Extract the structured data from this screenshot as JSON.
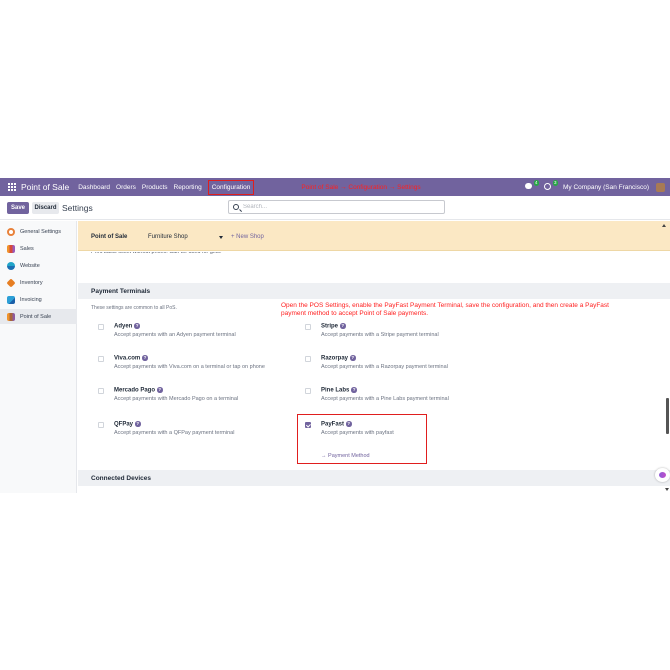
{
  "navbar": {
    "app_name": "Point of Sale",
    "menu": [
      "Dashboard",
      "Orders",
      "Products",
      "Reporting",
      "Configuration"
    ],
    "annotation": "Point of Sale → Configuration → Settings",
    "messages_count": "4",
    "activities_count": "3",
    "company": "My Company (San Francisco)"
  },
  "control": {
    "save_label": "Save",
    "discard_label": "Discard",
    "breadcrumb": "Settings",
    "search_placeholder": "Search..."
  },
  "sidebar": {
    "items": [
      {
        "label": "General Settings",
        "icon": "general-settings-icon"
      },
      {
        "label": "Sales",
        "icon": "sales-icon"
      },
      {
        "label": "Website",
        "icon": "website-icon"
      },
      {
        "label": "Inventory",
        "icon": "inventory-icon"
      },
      {
        "label": "Invoicing",
        "icon": "invoicing-icon"
      },
      {
        "label": "Point of Sale",
        "icon": "point-of-sale-icon",
        "active": true
      }
    ]
  },
  "main": {
    "pos_label": "Point of Sale",
    "shop_value": "Furniture Shop",
    "new_shop_label": "+ New Shop",
    "clipped_text": "Print basic ticket without prices. Can be used for gifts.",
    "payment_terminals": {
      "title": "Payment Terminals",
      "description": "These settings are common to all PoS.",
      "instruction": "Open the POS Settings, enable the PayFast Payment Terminal, save the configuration, and then create a PayFast payment method to accept Point of Sale payments.",
      "items": [
        {
          "name": "Adyen",
          "desc": "Accept payments with an Adyen payment terminal",
          "checked": false
        },
        {
          "name": "Stripe",
          "desc": "Accept payments with a Stripe payment terminal",
          "checked": false
        },
        {
          "name": "Viva.com",
          "desc": "Accept payments with Viva.com on a terminal or tap on phone",
          "checked": false
        },
        {
          "name": "Razorpay",
          "desc": "Accept payments with a Razorpay payment terminal",
          "checked": false
        },
        {
          "name": "Mercado Pago",
          "desc": "Accept payments with Mercado Pago on a terminal",
          "checked": false
        },
        {
          "name": "Pine Labs",
          "desc": "Accept payments with a Pine Labs payment terminal",
          "checked": false
        },
        {
          "name": "QFPay",
          "desc": "Accept payments with a QFPay payment terminal",
          "checked": false
        },
        {
          "name": "PayFast",
          "desc": "Accept payments with payfast",
          "checked": true,
          "link": "Payment Method"
        }
      ]
    },
    "connected_devices": {
      "title": "Connected Devices"
    }
  },
  "colors": {
    "navbar": "#71639e",
    "pos_bar": "#fbe8c4",
    "annotation": "#ff2020",
    "highlight_border": "#e01e1e"
  }
}
